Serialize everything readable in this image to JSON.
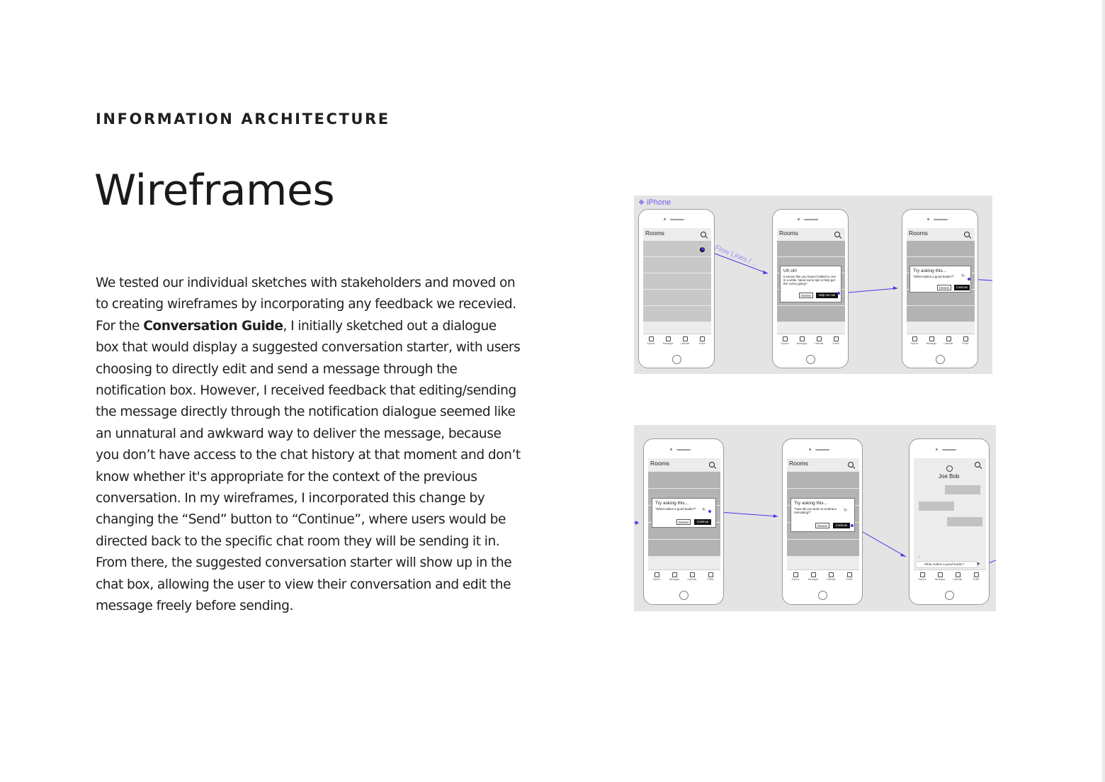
{
  "section_label": "INFORMATION ARCHITECTURE",
  "title": "Wireframes",
  "body": {
    "part1": "We tested our individual sketches with stakeholders and moved on to creating wireframes by incorporating any feedback we recevied. For the ",
    "bold": "Conversation Guide",
    "part2": ", I initially sketched out a dialogue box that would display a suggested conversation starter, with users choosing to directly edit and send a message through the notification box. However, I received feedback that editing/sending the message directly through the notification dialogue seemed like an unnatural and awkward way to deliver the message, because you don’t have access to the chat history at that moment and don’t know whether it's appropriate for the context of the previous conversation. In my wireframes, I incorporated this change by changing the “Send” button to “Continue”, where users would be directed back to the specific chat room they will be sending it in. From there, the suggested conversation starter will show up in the chat box, allowing the user to view their conversation and edit the message freely before sending."
  },
  "board_top": {
    "label": "iPhone",
    "flow_label": "Flow Lines / ...",
    "screens": [
      {
        "app_title": "Rooms",
        "badge": "!"
      },
      {
        "app_title": "Rooms",
        "dialog_title": "Uh oh!",
        "dialog_text": "It seems like you haven't talked to Joe in a while. Need some tips to help get the convo going?",
        "dismiss": "Dismiss",
        "primary": "Help me out!"
      },
      {
        "app_title": "Rooms",
        "dialog_title": "Try asking this...",
        "dialog_text": "\"What makes a good leader?\"",
        "dismiss": "Dismiss",
        "primary": "Continue"
      }
    ]
  },
  "board_bottom": {
    "screens": [
      {
        "app_title": "Rooms",
        "dialog_title": "Try asking this...",
        "dialog_text": "\"What makes a good leader?\"",
        "dismiss": "Dismiss",
        "primary": "Continue"
      },
      {
        "app_title": "Rooms",
        "dialog_title": "Try asking this...",
        "dialog_text": "\"How did you learn to embrace risk-taking?\"",
        "dismiss": "Dismiss",
        "primary": "Continue"
      },
      {
        "contact_name": "Joe Bob",
        "chat_input": "What makes a good leader?"
      }
    ]
  },
  "tabs": [
    "Explore",
    "Messages",
    "Calendar",
    "Profile"
  ]
}
